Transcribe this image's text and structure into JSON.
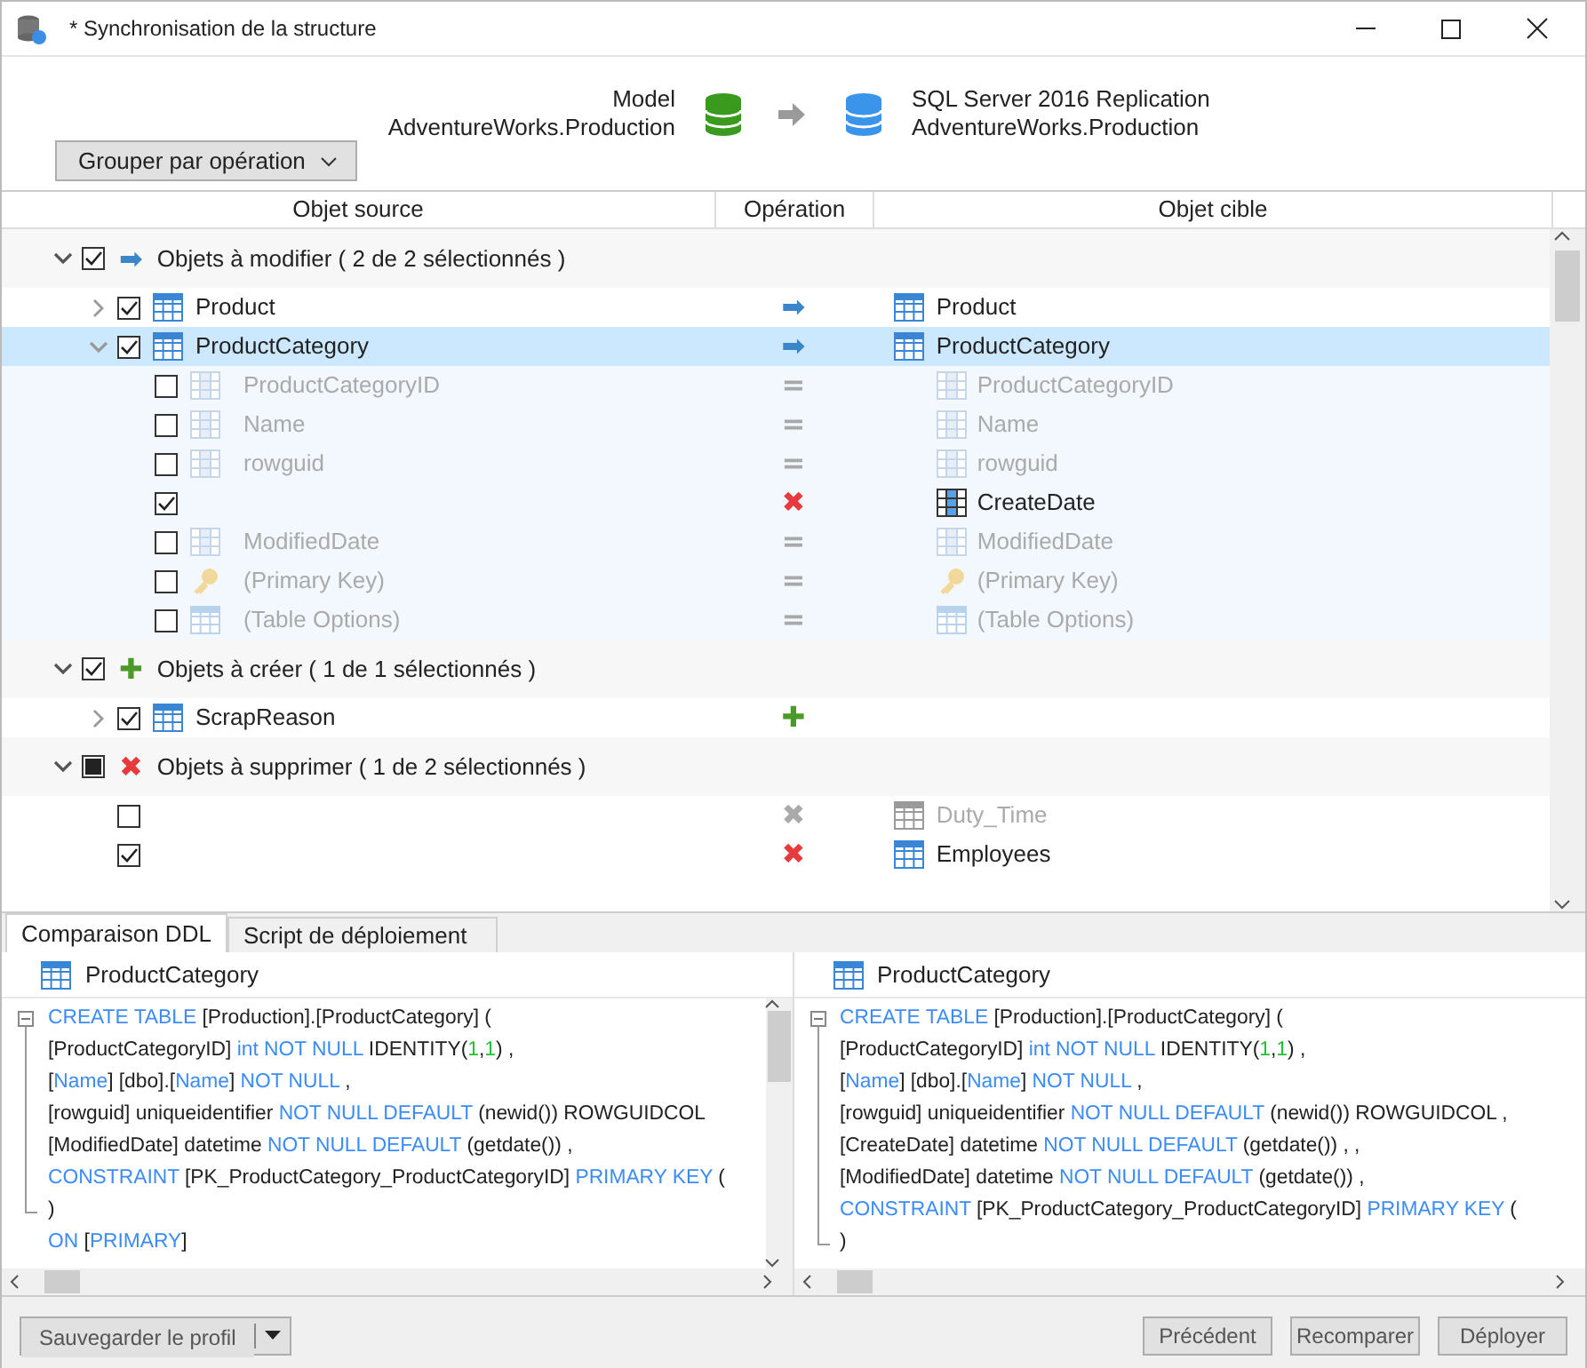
{
  "window": {
    "title": "* Synchronisation de la structure"
  },
  "header": {
    "source": {
      "label": "Model",
      "name": "AdventureWorks.Production"
    },
    "target": {
      "label": "SQL Server 2016 Replication",
      "name": "AdventureWorks.Production"
    },
    "group_button": "Grouper par opération"
  },
  "columns": [
    "Objet source",
    "Opération",
    "Objet cible"
  ],
  "groups": [
    {
      "title": "Objets à modifier ( 2 de 2 sélectionnés )",
      "op": "➡",
      "color": "#3a86c8",
      "checked": true,
      "expanded": true,
      "items": [
        {
          "source": "Product",
          "target": "Product",
          "kind": "table",
          "op": "➡",
          "color": "#3a86c8",
          "checked": true,
          "dim": false,
          "selected": false,
          "expanded": false
        },
        {
          "source": "ProductCategory",
          "target": "ProductCategory",
          "kind": "table",
          "op": "➡",
          "color": "#3a86c8",
          "checked": true,
          "dim": false,
          "selected": true,
          "expanded": true,
          "children": [
            {
              "source": "ProductCategoryID",
              "target": "ProductCategoryID",
              "kind": "column",
              "op": "=",
              "color": "#a8a8a8",
              "checked": false,
              "dim": true
            },
            {
              "source": "Name",
              "target": "Name",
              "kind": "column",
              "op": "=",
              "color": "#a8a8a8",
              "checked": false,
              "dim": true
            },
            {
              "source": "rowguid",
              "target": "rowguid",
              "kind": "column",
              "op": "=",
              "color": "#a8a8a8",
              "checked": false,
              "dim": true
            },
            {
              "target": "CreateDate",
              "kind": "column",
              "op": "✖",
              "color": "#e8393c",
              "checked": true,
              "dim": false
            },
            {
              "source": "ModifiedDate",
              "target": "ModifiedDate",
              "kind": "column",
              "op": "=",
              "color": "#a8a8a8",
              "checked": false,
              "dim": true
            },
            {
              "source": "(Primary Key)",
              "target": "(Primary Key)",
              "kind": "key",
              "op": "=",
              "color": "#a8a8a8",
              "checked": false,
              "dim": true
            },
            {
              "source": "(Table Options)",
              "target": "(Table Options)",
              "kind": "options",
              "op": "=",
              "color": "#a8a8a8",
              "checked": false,
              "dim": true
            }
          ]
        }
      ]
    },
    {
      "title": "Objets à créer ( 1 de 1 sélectionnés )",
      "op": "✚",
      "color": "#4a9a2a",
      "checked": true,
      "expanded": true,
      "items": [
        {
          "source": "ScrapReason",
          "kind": "table",
          "op": "✚",
          "color": "#4a9a2a",
          "checked": true,
          "dim": false,
          "selected": false,
          "expanded": false
        }
      ]
    },
    {
      "title": "Objets à supprimer ( 1 de 2 sélectionnés )",
      "op": "✖",
      "color": "#e8393c",
      "checked": false,
      "partial": true,
      "expanded": true,
      "items": [
        {
          "target": "Duty_Time",
          "kind": "table",
          "op": "✖",
          "color": "#aaaaaa",
          "checked": false,
          "dim": true,
          "selected": false
        },
        {
          "target": "Employees",
          "kind": "table",
          "op": "✖",
          "color": "#e8393c",
          "checked": true,
          "dim": false,
          "selected": false
        }
      ]
    }
  ],
  "tabs": [
    {
      "label": "Comparaison DDL",
      "selected": true
    },
    {
      "label": "Script de déploiement",
      "selected": false
    }
  ],
  "panes": [
    {
      "title": "ProductCategory",
      "lines": [
        {
          "kind": "fold-start",
          "tokens": [
            {
              "kind": "keyword",
              "text": "CREATE TABLE"
            },
            {
              "kind": "plain",
              "text": " [Production].[ProductCategory] ("
            }
          ]
        },
        {
          "kind": "fold-inside",
          "tokens": [
            {
              "kind": "plain",
              "text": "[ProductCategoryID] "
            },
            {
              "kind": "keyword",
              "text": "int NOT NULL"
            },
            {
              "kind": "plain",
              "text": " IDENTITY("
            },
            {
              "kind": "number",
              "text": "1"
            },
            {
              "kind": "plain",
              "text": ","
            },
            {
              "kind": "number",
              "text": "1"
            },
            {
              "kind": "plain",
              "text": ") ,"
            }
          ]
        },
        {
          "kind": "fold-inside",
          "tokens": [
            {
              "kind": "plain",
              "text": "["
            },
            {
              "kind": "keyword",
              "text": "Name"
            },
            {
              "kind": "plain",
              "text": "] [dbo].["
            },
            {
              "kind": "keyword",
              "text": "Name"
            },
            {
              "kind": "plain",
              "text": "] "
            },
            {
              "kind": "keyword",
              "text": "NOT NULL"
            },
            {
              "kind": "plain",
              "text": " ,"
            }
          ]
        },
        {
          "kind": "fold-inside",
          "tokens": [
            {
              "kind": "plain",
              "text": "[rowguid] uniqueidentifier "
            },
            {
              "kind": "keyword",
              "text": "NOT NULL DEFAULT"
            },
            {
              "kind": "plain",
              "text": " (newid()) ROWGUIDCOL"
            }
          ]
        },
        {
          "kind": "fold-inside",
          "tokens": [
            {
              "kind": "plain",
              "text": "[ModifiedDate] datetime "
            },
            {
              "kind": "keyword",
              "text": "NOT NULL DEFAULT"
            },
            {
              "kind": "plain",
              "text": " (getdate()) ,"
            }
          ]
        },
        {
          "kind": "fold-inside",
          "tokens": [
            {
              "kind": "keyword",
              "text": "CONSTRAINT"
            },
            {
              "kind": "plain",
              "text": " [PK_ProductCategory_ProductCategoryID] "
            },
            {
              "kind": "keyword",
              "text": "PRIMARY KEY"
            },
            {
              "kind": "plain",
              "text": " ("
            }
          ]
        },
        {
          "kind": "fold-end",
          "tokens": [
            {
              "kind": "plain",
              "text": ")"
            }
          ]
        },
        {
          "kind": "plain",
          "tokens": [
            {
              "kind": "keyword",
              "text": "ON"
            },
            {
              "kind": "plain",
              "text": " ["
            },
            {
              "kind": "keyword",
              "text": "PRIMARY"
            },
            {
              "kind": "plain",
              "text": "]"
            }
          ]
        }
      ]
    },
    {
      "title": "ProductCategory",
      "lines": [
        {
          "kind": "fold-start",
          "tokens": [
            {
              "kind": "keyword",
              "text": "CREATE TABLE"
            },
            {
              "kind": "plain",
              "text": " [Production].[ProductCategory] ("
            }
          ]
        },
        {
          "kind": "fold-inside",
          "tokens": [
            {
              "kind": "plain",
              "text": "[ProductCategoryID] "
            },
            {
              "kind": "keyword",
              "text": "int NOT NULL"
            },
            {
              "kind": "plain",
              "text": " IDENTITY("
            },
            {
              "kind": "number",
              "text": "1"
            },
            {
              "kind": "plain",
              "text": ","
            },
            {
              "kind": "number",
              "text": "1"
            },
            {
              "kind": "plain",
              "text": ") ,"
            }
          ]
        },
        {
          "kind": "fold-inside",
          "tokens": [
            {
              "kind": "plain",
              "text": "["
            },
            {
              "kind": "keyword",
              "text": "Name"
            },
            {
              "kind": "plain",
              "text": "] [dbo].["
            },
            {
              "kind": "keyword",
              "text": "Name"
            },
            {
              "kind": "plain",
              "text": "] "
            },
            {
              "kind": "keyword",
              "text": "NOT NULL"
            },
            {
              "kind": "plain",
              "text": " ,"
            }
          ]
        },
        {
          "kind": "fold-inside",
          "tokens": [
            {
              "kind": "plain",
              "text": "[rowguid] uniqueidentifier "
            },
            {
              "kind": "keyword",
              "text": "NOT NULL DEFAULT"
            },
            {
              "kind": "plain",
              "text": " (newid()) ROWGUIDCOL ,"
            }
          ]
        },
        {
          "kind": "fold-inside",
          "tokens": [
            {
              "kind": "plain",
              "text": "[CreateDate] datetime "
            },
            {
              "kind": "keyword",
              "text": "NOT NULL DEFAULT"
            },
            {
              "kind": "plain",
              "text": " (getdate()) , ,"
            }
          ]
        },
        {
          "kind": "fold-inside",
          "tokens": [
            {
              "kind": "plain",
              "text": "[ModifiedDate] datetime "
            },
            {
              "kind": "keyword",
              "text": "NOT NULL DEFAULT"
            },
            {
              "kind": "plain",
              "text": " (getdate()) ,"
            }
          ]
        },
        {
          "kind": "fold-inside",
          "tokens": [
            {
              "kind": "keyword",
              "text": "CONSTRAINT"
            },
            {
              "kind": "plain",
              "text": " [PK_ProductCategory_ProductCategoryID] "
            },
            {
              "kind": "keyword",
              "text": "PRIMARY KEY"
            },
            {
              "kind": "plain",
              "text": " ("
            }
          ]
        },
        {
          "kind": "fold-end",
          "tokens": [
            {
              "kind": "plain",
              "text": ")"
            }
          ]
        }
      ]
    }
  ],
  "footer": {
    "save_button": "Sauvegarder le profil",
    "buttons": [
      "Précédent",
      "Recomparer",
      "Déployer"
    ]
  }
}
